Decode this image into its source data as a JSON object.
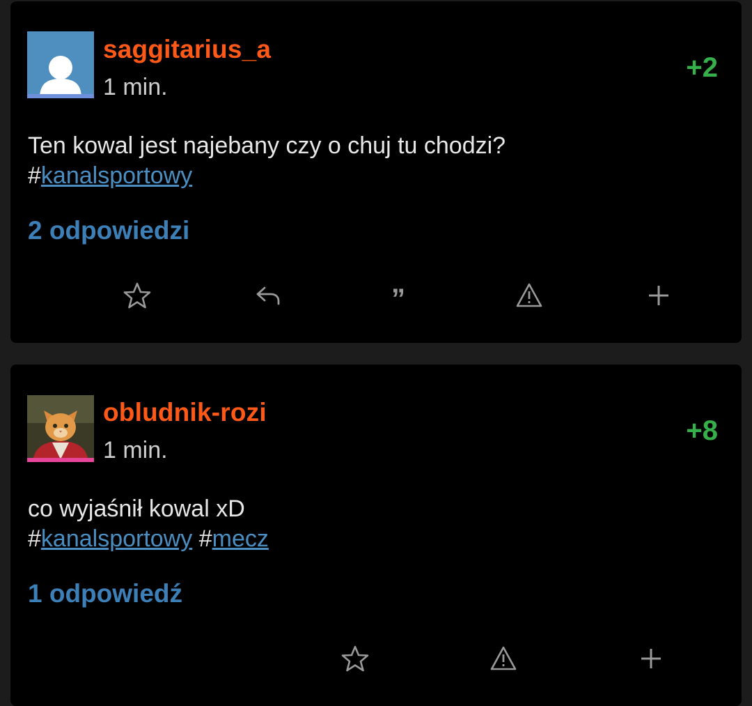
{
  "posts": [
    {
      "username": "saggitarius_a",
      "time": "1 min.",
      "score": "+2",
      "text": "Ten kowal jest najebany czy o chuj tu chodzi?",
      "tags": [
        "kanalsportowy"
      ],
      "replies": "2 odpowiedzi",
      "avatar_stripe_color": "#6e8fd9",
      "actions": [
        "star-icon",
        "reply-icon",
        "quote-icon",
        "warning-icon",
        "plus-icon"
      ]
    },
    {
      "username": "obludnik-rozi",
      "time": "1 min.",
      "score": "+8",
      "text": "co wyjaśnił kowal xD",
      "tags": [
        "kanalsportowy",
        "mecz"
      ],
      "replies": "1 odpowiedź",
      "avatar_stripe_color": "#e8459a",
      "actions": [
        "star-icon",
        "warning-icon",
        "plus-icon"
      ]
    }
  ],
  "hash_symbol": "#",
  "quote_glyph": "”",
  "colors": {
    "username": "#ff5917",
    "score": "#36b04a",
    "link": "#4a8ec2",
    "replies": "#3d7fb7",
    "card_bg": "#000000",
    "page_bg": "#1c1c1c"
  }
}
